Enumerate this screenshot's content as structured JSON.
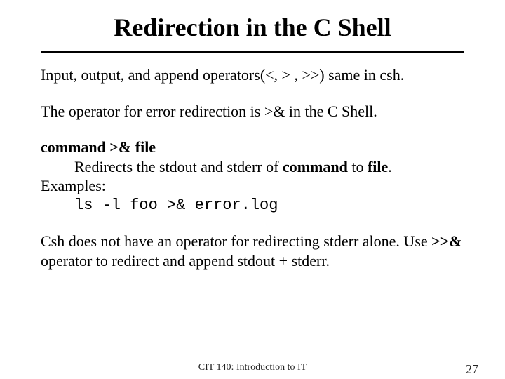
{
  "title": "Redirection in the C Shell",
  "p1": "Input, output, and append operators(<, > , >>) same in csh.",
  "p2": "The operator for error redirection is >& in the C Shell.",
  "syntax": "command >& file",
  "desc_a": "Redirects the stdout and stderr of ",
  "desc_b1": "command",
  "desc_b": " to ",
  "desc_b2": "file",
  "desc_c": ".",
  "examples_label": "Examples:",
  "example_cmd": "ls -l  foo >& error.log",
  "p4a": "Csh does not have  an operator for redirecting stderr alone. Use ",
  "p4op": ">>&",
  "p4b": " operator to redirect and append stdout + stderr.",
  "footer_center": "CIT 140: Introduction to IT",
  "footer_right": "27"
}
